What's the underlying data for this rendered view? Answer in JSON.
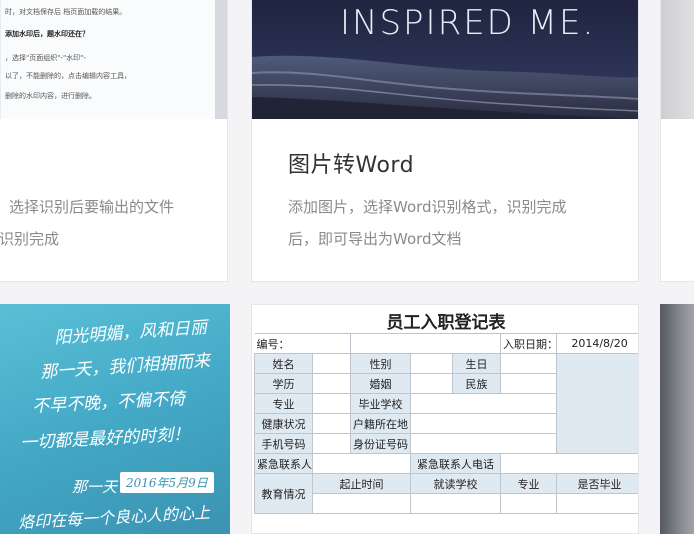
{
  "cards": {
    "left_top": {
      "doc_heading": "添加水印后，题水印还在？",
      "doc_lines": [
        "时，对文档保存后 档页面加载的结果。",
        "，选择\"页面组织\"-\"水印\"-",
        "以了，不能删除的，点击编辑内容工具，",
        "删除的水印内容，进行删除。"
      ],
      "desc_line1": "选择识别后要输出的文件",
      "desc_line2": "识别完成"
    },
    "middle_top": {
      "image_text": "INSPIRED ME.",
      "title": "图片转Word",
      "desc_line1": "添加图片，选择Word识别格式，识别完成",
      "desc_line2": "后，即可导出为Word文档"
    },
    "left_bottom": {
      "handwriting": [
        "阳光明媚，风和日丽",
        "那一天，我们相拥而来",
        "不早不晚，不偏不倚",
        "一切都是最好的时刻！"
      ],
      "signature_prefix": "那一天",
      "signature_date": "2016年5月9日",
      "bottom_line": "烙印在每一个良心人的心上"
    },
    "middle_bottom": {
      "table_title": "员工入职登记表",
      "rows": {
        "r1": {
          "c1": "编号：",
          "c2": "入职日期：",
          "c3": "2014/8/20"
        },
        "r2": {
          "c1": "姓名",
          "c2": "性别",
          "c3": "生日"
        },
        "r3": {
          "c1": "学历",
          "c2": "婚姻",
          "c3": "民族"
        },
        "r4": {
          "c1": "专业",
          "c2": "毕业学校"
        },
        "r5": {
          "c1": "健康状况",
          "c2": "户籍所在地"
        },
        "r6": {
          "c1": "手机号码",
          "c2": "身份证号码"
        },
        "r7": {
          "c1": "紧急联系人",
          "c2": "紧急联系人电话"
        },
        "r8": {
          "c1": "起止时间",
          "c2": "就读学校",
          "c3": "专业",
          "c4": "是否毕业"
        },
        "r9": {
          "c1": "教育情况"
        }
      }
    }
  },
  "colors": {
    "page_bg": "#f4f4f6",
    "card_bg": "#ffffff",
    "title_text": "#333333",
    "desc_text": "#8a8a8a",
    "table_label_bg": "#dfe9f1"
  }
}
